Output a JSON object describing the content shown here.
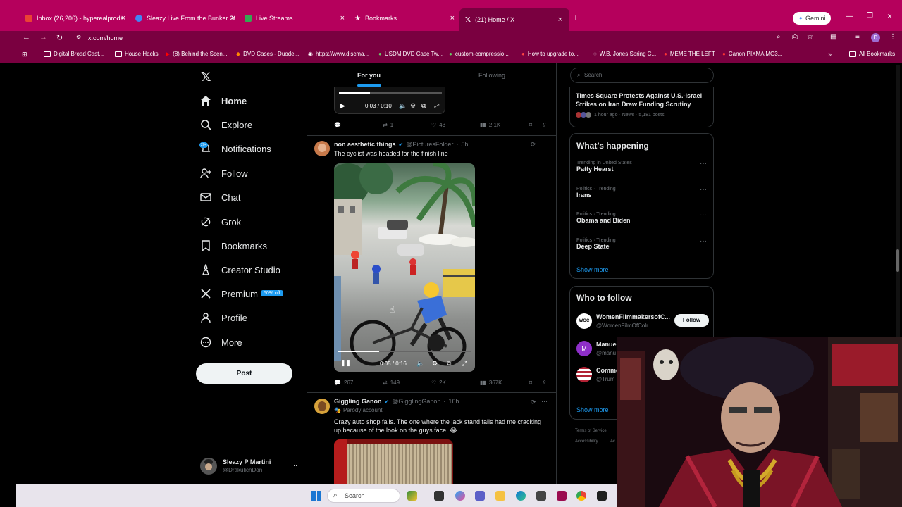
{
  "browser": {
    "tabs": [
      {
        "title": "Inbox (26,206) - hyperealprods",
        "icon_color": "#ea4335"
      },
      {
        "title": "Sleazy Live From the Bunker 2/",
        "icon_color": "#4285f4"
      },
      {
        "title": "Live Streams",
        "icon_color": "#34a853"
      },
      {
        "title": "Bookmarks",
        "icon_color": "#ffffff"
      },
      {
        "title": "(21) Home / X",
        "icon_color": "#ffffff"
      }
    ],
    "gemini_label": "Gemini",
    "url": "x.com/home",
    "bookmarks": [
      "Digital Broad Cast...",
      "House Hacks",
      "(8) Behind the Scen...",
      "DVD Cases - Duode...",
      "https://www.discma...",
      "USDM DVD Case Tw...",
      "custom-compressio...",
      "How to upgrade to...",
      "W.B. Jones Spring C...",
      "MEME THE LEFT",
      "Canon PIXMA MG3..."
    ],
    "all_bookmarks": "All Bookmarks",
    "profile_initial": "D"
  },
  "nav": {
    "items": [
      {
        "label": "Home",
        "icon": "home-icon"
      },
      {
        "label": "Explore",
        "icon": "search-icon"
      },
      {
        "label": "Notifications",
        "icon": "bell-icon",
        "badge": "20+"
      },
      {
        "label": "Follow",
        "icon": "person-add-icon"
      },
      {
        "label": "Chat",
        "icon": "mail-icon"
      },
      {
        "label": "Grok",
        "icon": "grok-icon"
      },
      {
        "label": "Bookmarks",
        "icon": "bookmark-icon"
      },
      {
        "label": "Creator Studio",
        "icon": "creator-icon"
      },
      {
        "label": "Premium",
        "icon": "x-icon",
        "badge": "50% off"
      },
      {
        "label": "Profile",
        "icon": "profile-icon"
      },
      {
        "label": "More",
        "icon": "more-icon"
      }
    ],
    "post_button": "Post",
    "account": {
      "name": "Sleazy P Martini",
      "handle": "@DrakulichDon"
    }
  },
  "feed": {
    "tabs": [
      "For you",
      "Following"
    ],
    "top_video": {
      "time": "0:03 / 0:10",
      "replies": "",
      "reposts": "1",
      "likes": "43",
      "views": "2.1K"
    },
    "tweets": [
      {
        "name": "non aesthetic things",
        "handle": "@PicturesFolder",
        "time": "5h",
        "text": "The cyclist was headed for the finish line",
        "video_time": "0:05 / 0:16",
        "replies": "267",
        "reposts": "149",
        "likes": "2K",
        "views": "367K"
      },
      {
        "name": "Giggling Ganon",
        "handle": "@GigglingGanon",
        "time": "16h",
        "subtitle": "Parody account",
        "text": "Crazy auto shop falls. The one where the jack stand falls had me cracking up because of the look on the guys face. 😂"
      }
    ]
  },
  "sidebar": {
    "search_placeholder": "Search",
    "news": {
      "title": "Times Square Protests Against U.S.-Israel Strikes on Iran Draw Funding Scrutiny",
      "meta": "1 hour ago · News · 5,181 posts"
    },
    "whats_happening": {
      "title": "What’s happening",
      "trends": [
        {
          "category": "Trending in United States",
          "name": "Patty Hearst"
        },
        {
          "category": "Politics · Trending",
          "name": "Irans"
        },
        {
          "category": "Politics · Trending",
          "name": "Obama and Biden"
        },
        {
          "category": "Politics · Trending",
          "name": "Deep State"
        }
      ],
      "show_more": "Show more"
    },
    "who_to_follow": {
      "title": "Who to follow",
      "accounts": [
        {
          "name": "WomenFilmmakersofC...",
          "handle": "@WomenFilmOfColr",
          "follow": "Follow"
        },
        {
          "name": "Manue",
          "handle": "@manu"
        },
        {
          "name": "Comme",
          "handle": "@Trum"
        }
      ],
      "show_more": "Show more"
    },
    "footer": [
      "Terms of Service",
      "Accessibility",
      "Ac"
    ]
  },
  "taskbar": {
    "search": "Search"
  }
}
